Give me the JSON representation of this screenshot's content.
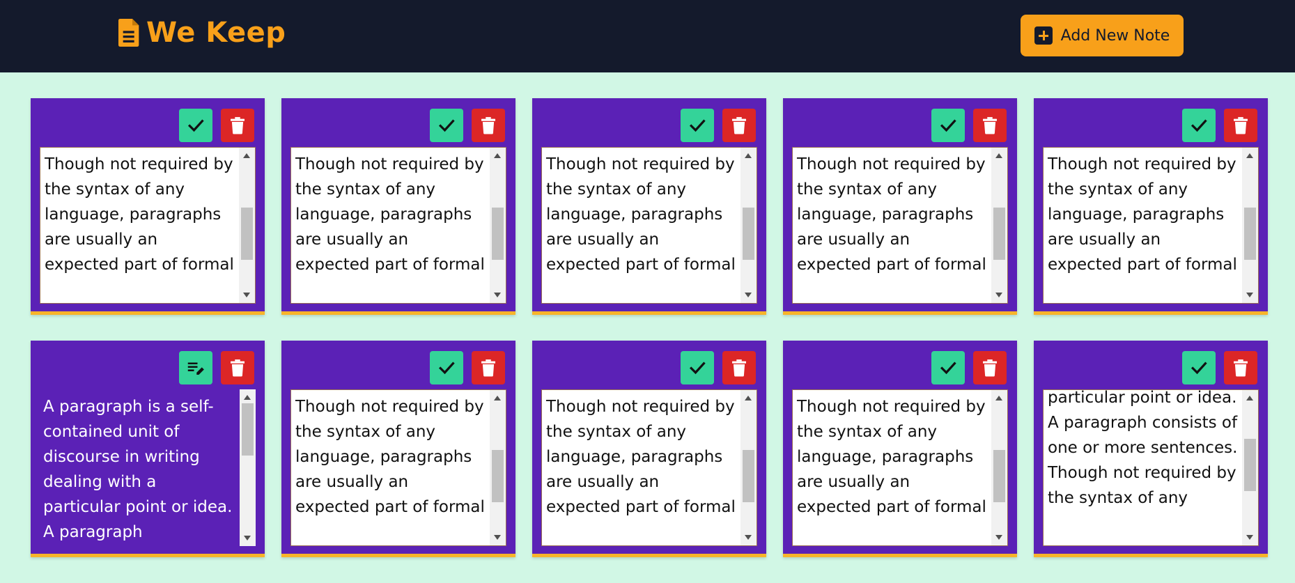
{
  "header": {
    "brand": "We Keep",
    "brand_icon": "document-icon",
    "add_button_label": "Add New Note",
    "add_button_icon": "plus-square-icon"
  },
  "colors": {
    "header_bg": "#141a2c",
    "accent": "#f8a01a",
    "page_bg": "#d1f7e5",
    "card_bg": "#5b21b6",
    "save_button": "#34d399",
    "delete_button": "#dc2626"
  },
  "notes": [
    {
      "text": "Though not required by the syntax of any language, paragraphs are usually an expected part of formal",
      "mode": "editing",
      "scroll_fraction": 0.6
    },
    {
      "text": "Though not required by the syntax of any language, paragraphs are usually an expected part of formal",
      "mode": "editing",
      "scroll_fraction": 0.6
    },
    {
      "text": "Though not required by the syntax of any language, paragraphs are usually an expected part of formal",
      "mode": "editing",
      "scroll_fraction": 0.6
    },
    {
      "text": "Though not required by the syntax of any language, paragraphs are usually an expected part of formal",
      "mode": "editing",
      "scroll_fraction": 0.6
    },
    {
      "text": "Though not required by the syntax of any language, paragraphs are usually an expected part of formal",
      "mode": "editing",
      "scroll_fraction": 0.6
    },
    {
      "text": "A paragraph is a self-contained unit of discourse in writing dealing with a particular point or idea. A paragraph",
      "mode": "view",
      "scroll_fraction": 0.0
    },
    {
      "text": "Though not required by the syntax of any language, paragraphs are usually an expected part of formal",
      "mode": "editing",
      "scroll_fraction": 0.6
    },
    {
      "text": "Though not required by the syntax of any language, paragraphs are usually an expected part of formal",
      "mode": "editing",
      "scroll_fraction": 0.6
    },
    {
      "text": "Though not required by the syntax of any language, paragraphs are usually an expected part of formal",
      "mode": "editing",
      "scroll_fraction": 0.6
    },
    {
      "text": "particular point or idea. A paragraph consists of one or more sentences. Though not required by the syntax of any",
      "mode": "editing",
      "scroll_fraction": 0.45
    }
  ]
}
